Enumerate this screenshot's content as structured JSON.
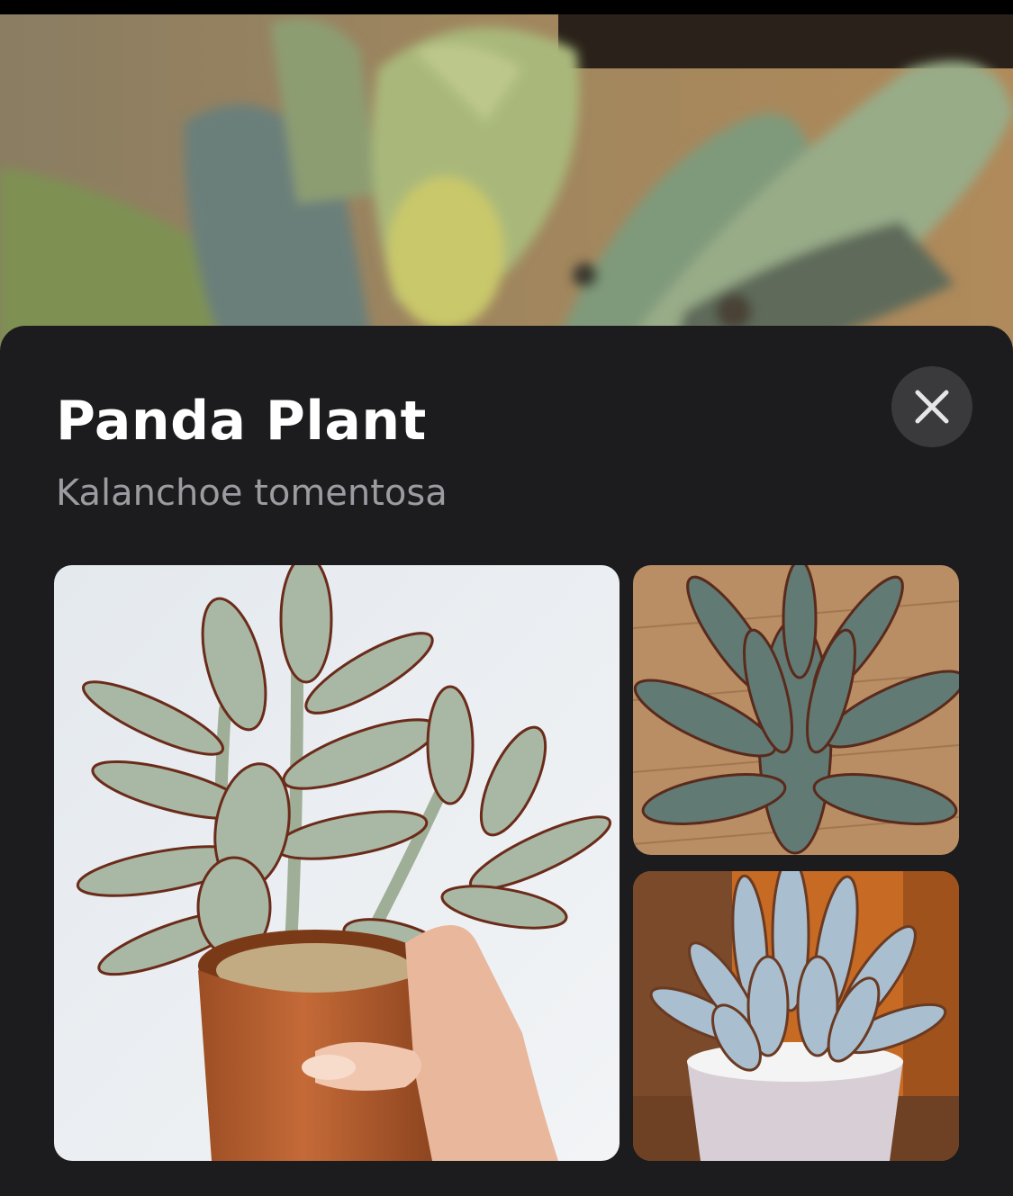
{
  "plant": {
    "name": "Panda Plant",
    "scientific_name": "Kalanchoe tomentosa"
  },
  "icons": {
    "close": "close-icon"
  },
  "colors": {
    "sheet_background": "#1c1c1e",
    "close_button_background": "#3a3a3c",
    "title": "#ffffff",
    "subtitle": "#9b9ba1"
  }
}
